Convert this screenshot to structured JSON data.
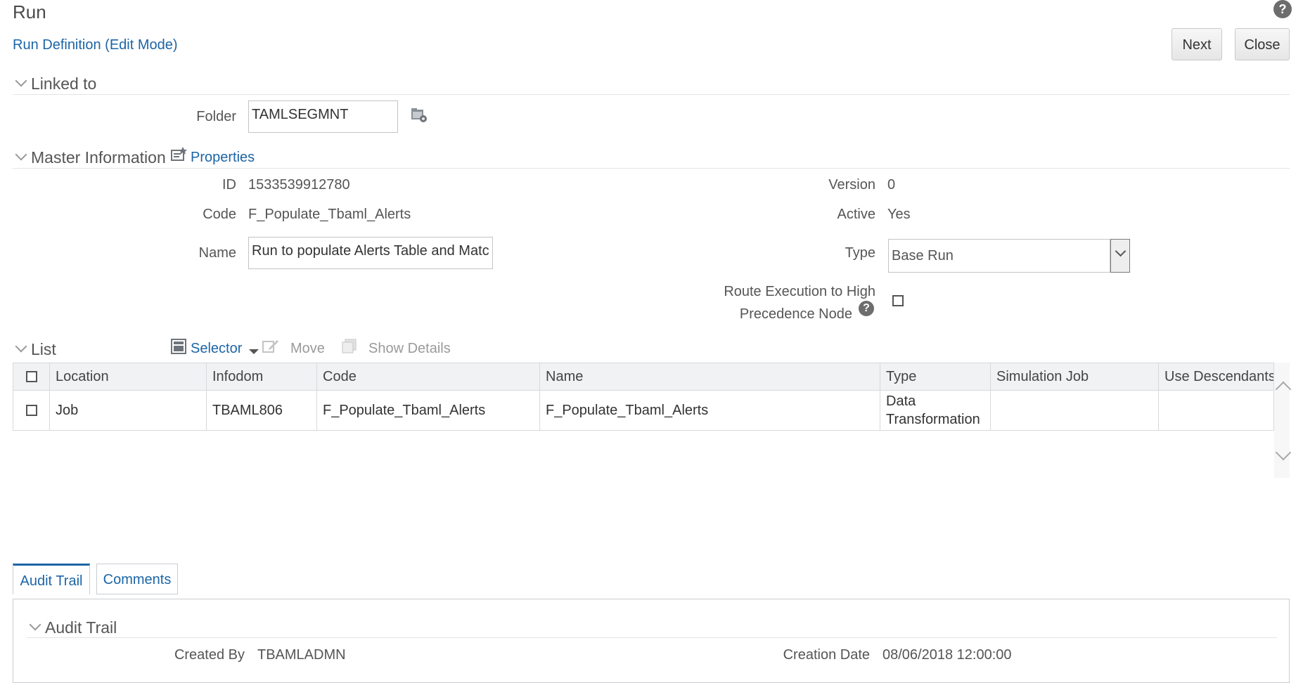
{
  "page": {
    "title": "Run",
    "subtitle": "Run Definition (Edit Mode)",
    "help_glyph": "?"
  },
  "toolbar": {
    "next_label": "Next",
    "close_label": "Close"
  },
  "linked_to": {
    "section_title": "Linked to",
    "folder_label": "Folder",
    "folder_value": "TAMLSEGMNT"
  },
  "master": {
    "section_title": "Master Information",
    "properties_label": "Properties",
    "id_label": "ID",
    "id_value": "1533539912780",
    "code_label": "Code",
    "code_value": "F_Populate_Tbaml_Alerts",
    "name_label": "Name",
    "name_value": "Run to populate Alerts Table and Matc",
    "version_label": "Version",
    "version_value": "0",
    "active_label": "Active",
    "active_value": "Yes",
    "type_label": "Type",
    "type_value": "Base Run",
    "route_label_line1": "Route Execution to High",
    "route_label_line2": "Precedence Node",
    "route_checked": false
  },
  "list": {
    "section_title": "List",
    "selector_label": "Selector",
    "move_label": "Move",
    "show_details_label": "Show Details",
    "columns": [
      "Location",
      "Infodom",
      "Code",
      "Name",
      "Type",
      "Simulation Job",
      "Use Descendants"
    ],
    "rows": [
      {
        "location": "Job",
        "infodom": "TBAML806",
        "code": "F_Populate_Tbaml_Alerts",
        "name": "F_Populate_Tbaml_Alerts",
        "type_line1": "Data",
        "type_line2": "Transformation",
        "simulation_job": "",
        "use_descendants": ""
      }
    ]
  },
  "tabs": [
    {
      "label": "Audit Trail",
      "active": true
    },
    {
      "label": "Comments",
      "active": false
    }
  ],
  "audit": {
    "section_title": "Audit Trail",
    "created_by_label": "Created By",
    "created_by_value": "TBAMLADMN",
    "creation_date_label": "Creation Date",
    "creation_date_value": "08/06/2018 12:00:00"
  },
  "colors": {
    "accent": "#1c65a6",
    "border": "#d7d9dc",
    "header_bg": "#f1f2f4"
  }
}
